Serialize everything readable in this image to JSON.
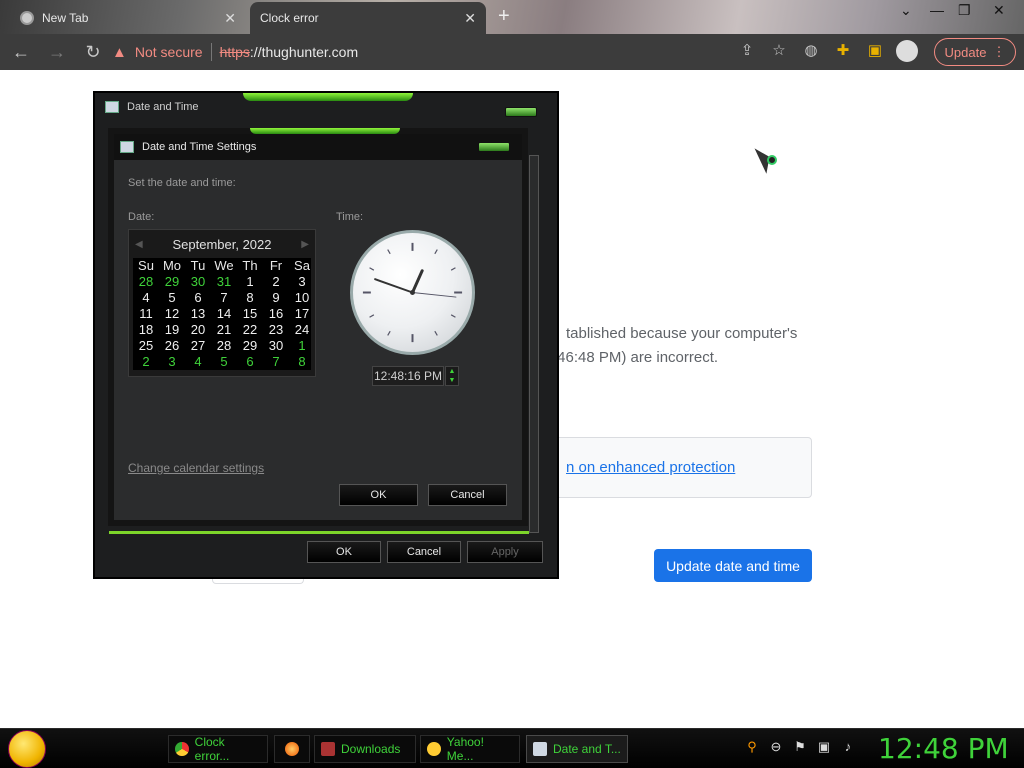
{
  "browser": {
    "tabs": [
      {
        "title": "New Tab",
        "active": false
      },
      {
        "title": "Clock error",
        "active": true
      }
    ],
    "security_label": "Not secure",
    "url_scheme": "https",
    "url_rest": "://thughunter.com",
    "update_label": "Update"
  },
  "page": {
    "error_line_1": "tablished because your computer's",
    "error_line_2": ":46:48 PM) are incorrect.",
    "enhanced_link": "n on enhanced protection",
    "update_button": "Update date and time"
  },
  "outer_dialog": {
    "title": "Date and Time",
    "ok": "OK",
    "cancel": "Cancel",
    "apply": "Apply"
  },
  "inner_dialog": {
    "title": "Date and Time Settings",
    "instruction": "Set the date and time:",
    "date_label": "Date:",
    "time_label": "Time:",
    "month_year": "September, 2022",
    "weekdays": [
      "Su",
      "Mo",
      "Tu",
      "We",
      "Th",
      "Fr",
      "Sa"
    ],
    "weeks": [
      [
        "28",
        "29",
        "30",
        "31",
        "1",
        "2",
        "3"
      ],
      [
        "4",
        "5",
        "6",
        "7",
        "8",
        "9",
        "10"
      ],
      [
        "11",
        "12",
        "13",
        "14",
        "15",
        "16",
        "17"
      ],
      [
        "18",
        "19",
        "20",
        "21",
        "22",
        "23",
        "24"
      ],
      [
        "25",
        "26",
        "27",
        "28",
        "29",
        "30",
        "1"
      ],
      [
        "2",
        "3",
        "4",
        "5",
        "6",
        "7",
        "8"
      ]
    ],
    "other_month_cells": [
      [
        0,
        0
      ],
      [
        0,
        1
      ],
      [
        0,
        2
      ],
      [
        0,
        3
      ],
      [
        4,
        6
      ],
      [
        5,
        0
      ],
      [
        5,
        1
      ],
      [
        5,
        2
      ],
      [
        5,
        3
      ],
      [
        5,
        4
      ],
      [
        5,
        5
      ],
      [
        5,
        6
      ]
    ],
    "time_value": "12:48:16 PM",
    "change_calendar_link": "Change calendar settings",
    "ok": "OK",
    "cancel": "Cancel"
  },
  "taskbar": {
    "items": [
      {
        "label": "Clock error...",
        "icon": "chrome-icon",
        "active": false
      },
      {
        "label": "",
        "icon": "firefox-icon",
        "active": false
      },
      {
        "label": "Downloads",
        "icon": "downloads-icon",
        "active": false
      },
      {
        "label": "Yahoo! Me...",
        "icon": "yahoo-messenger-icon",
        "active": false
      },
      {
        "label": "Date and T...",
        "icon": "date-time-icon",
        "active": true
      }
    ],
    "clock": "12:48 PM"
  },
  "colors": {
    "accent_green": "#3fd23a",
    "chrome_blue": "#1a73e8",
    "warning_red": "#f28b82"
  }
}
